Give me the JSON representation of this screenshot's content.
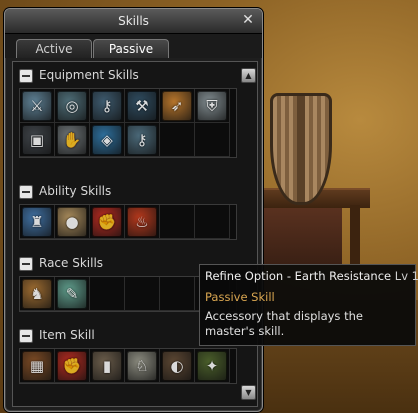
{
  "window": {
    "title": "Skills",
    "close_glyph": "✕"
  },
  "tabs": [
    {
      "label": "Active",
      "active": false
    },
    {
      "label": "Passive",
      "active": true
    }
  ],
  "sections": [
    {
      "label": "Equipment Skills",
      "icons": [
        {
          "name": "sword-icon",
          "glyph": "⚔",
          "color": "#5d7f93"
        },
        {
          "name": "swirl-icon",
          "glyph": "◎",
          "color": "#4e6d77"
        },
        {
          "name": "key-ring-icon",
          "glyph": "⚷",
          "color": "#3d5a6e"
        },
        {
          "name": "axe-icon",
          "glyph": "⚒",
          "color": "#2f4c60"
        },
        {
          "name": "spear-icon",
          "glyph": "➶",
          "color": "#b5742b"
        },
        {
          "name": "armor-icon",
          "glyph": "⛨",
          "color": "#7f8a8e"
        },
        {
          "name": "belt-icon",
          "glyph": "▣",
          "color": "#3e4348"
        },
        {
          "name": "gauntlet-icon",
          "glyph": "✋",
          "color": "#6b7275"
        },
        {
          "name": "shield-crest-icon",
          "glyph": "◈",
          "color": "#2d6e9b"
        },
        {
          "name": "ring-key-icon",
          "glyph": "⚷",
          "color": "#4a6878"
        },
        {
          "name": "",
          "glyph": "",
          "color": ""
        },
        {
          "name": "",
          "glyph": "",
          "color": ""
        }
      ]
    },
    {
      "label": "Ability Skills",
      "icons": [
        {
          "name": "chair-icon",
          "glyph": "♜",
          "color": "#3f6fa1"
        },
        {
          "name": "coin-icon",
          "glyph": "●",
          "color": "#a6895a"
        },
        {
          "name": "fire-hand-icon",
          "glyph": "✊",
          "color": "#b52a20"
        },
        {
          "name": "flame-icon",
          "glyph": "♨",
          "color": "#b4381c"
        },
        {
          "name": "",
          "glyph": "",
          "color": ""
        },
        {
          "name": "",
          "glyph": "",
          "color": ""
        }
      ]
    },
    {
      "label": "Race Skills",
      "icons": [
        {
          "name": "bag-icon",
          "glyph": "♞",
          "color": "#9b6a30"
        },
        {
          "name": "scroll-icon",
          "glyph": "✎",
          "color": "#5e9b8a"
        },
        {
          "name": "",
          "glyph": "",
          "color": ""
        },
        {
          "name": "",
          "glyph": "",
          "color": ""
        },
        {
          "name": "",
          "glyph": "",
          "color": ""
        },
        {
          "name": "",
          "glyph": "",
          "color": ""
        }
      ]
    },
    {
      "label": "Item Skill",
      "icons": [
        {
          "name": "chest-icon",
          "glyph": "▦",
          "color": "#7b4a24"
        },
        {
          "name": "red-hand-icon",
          "glyph": "✊",
          "color": "#b02a20"
        },
        {
          "name": "bracer-icon",
          "glyph": "▮",
          "color": "#6a5c4a"
        },
        {
          "name": "knight-icon",
          "glyph": "♘",
          "color": "#8a8a7e"
        },
        {
          "name": "barrel-shield-icon",
          "glyph": "◐",
          "color": "#5b4632"
        },
        {
          "name": "earth-resistance-icon",
          "glyph": "✦",
          "color": "#4a5e2a"
        }
      ]
    }
  ],
  "tooltip": {
    "title": "Refine Option - Earth Resistance",
    "level": "Lv 1",
    "type": "Passive Skill",
    "description": "Accessory that displays the master's skill."
  },
  "scroll": {
    "up_glyph": "▲",
    "down_glyph": "▼"
  }
}
